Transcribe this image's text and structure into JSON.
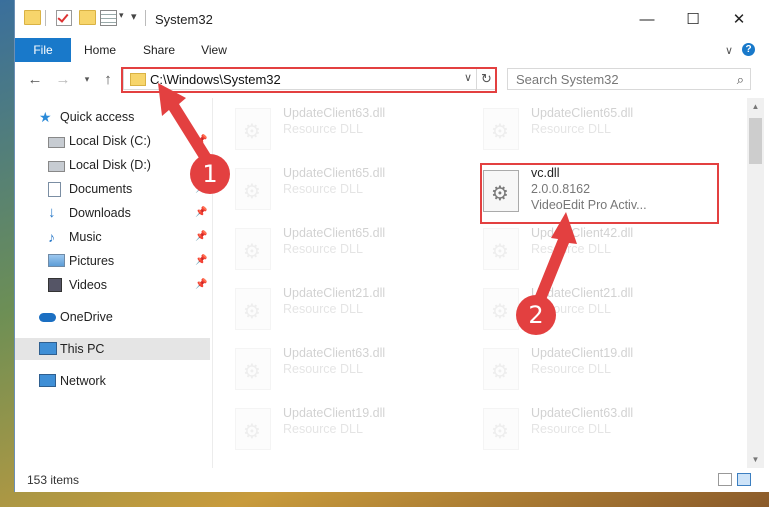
{
  "window": {
    "title": "System32",
    "buttons": {
      "minimize": "—",
      "maximize": "☐",
      "close": "✕"
    }
  },
  "ribbon": {
    "tabs": [
      "File",
      "Home",
      "Share",
      "View"
    ],
    "help": "?"
  },
  "nav": {
    "address": "C:\\Windows\\System32",
    "search_placeholder": "Search System32"
  },
  "sidebar": {
    "items": [
      {
        "label": "Quick access",
        "icon": "star-icon",
        "pinned": false
      },
      {
        "label": "Local Disk (C:)",
        "icon": "drive-icon",
        "pinned": true
      },
      {
        "label": "Local Disk (D:)",
        "icon": "drive-icon",
        "pinned": false
      },
      {
        "label": "Documents",
        "icon": "documents-icon",
        "pinned": true
      },
      {
        "label": "Downloads",
        "icon": "downloads-icon",
        "pinned": true
      },
      {
        "label": "Music",
        "icon": "music-icon",
        "pinned": true
      },
      {
        "label": "Pictures",
        "icon": "pictures-icon",
        "pinned": true
      },
      {
        "label": "Videos",
        "icon": "videos-icon",
        "pinned": true
      },
      {
        "label": "OneDrive",
        "icon": "onedrive-icon",
        "pinned": false
      },
      {
        "label": "This PC",
        "icon": "pc-icon",
        "pinned": false
      },
      {
        "label": "Network",
        "icon": "network-icon",
        "pinned": false
      }
    ]
  },
  "files": {
    "left": [
      {
        "name": "UpdateClient63.dll",
        "type": "Resource DLL"
      },
      {
        "name": "UpdateClient65.dll",
        "type": "Resource DLL"
      },
      {
        "name": "UpdateClient65.dll",
        "type": "Resource DLL"
      },
      {
        "name": "UpdateClient21.dll",
        "type": "Resource DLL"
      },
      {
        "name": "UpdateClient63.dll",
        "type": "Resource DLL"
      },
      {
        "name": "UpdateClient19.dll",
        "type": "Resource DLL"
      }
    ],
    "right": [
      {
        "name": "UpdateClient65.dll",
        "type": "Resource DLL"
      },
      {
        "name": "UpdateClient42.dll",
        "type": "Resource DLL"
      },
      {
        "name": "UpdateClient21.dll",
        "type": "Resource DLL"
      },
      {
        "name": "UpdateClient19.dll",
        "type": "Resource DLL"
      },
      {
        "name": "UpdateClient63.dll",
        "type": "Resource DLL"
      }
    ],
    "highlighted": {
      "name": "vc.dll",
      "version": "2.0.0.8162",
      "description": "VideoEdit Pro Activ..."
    }
  },
  "status": {
    "item_count": "153 items"
  },
  "annotations": {
    "step1": "1",
    "step2": "2",
    "color": "#e34040"
  }
}
